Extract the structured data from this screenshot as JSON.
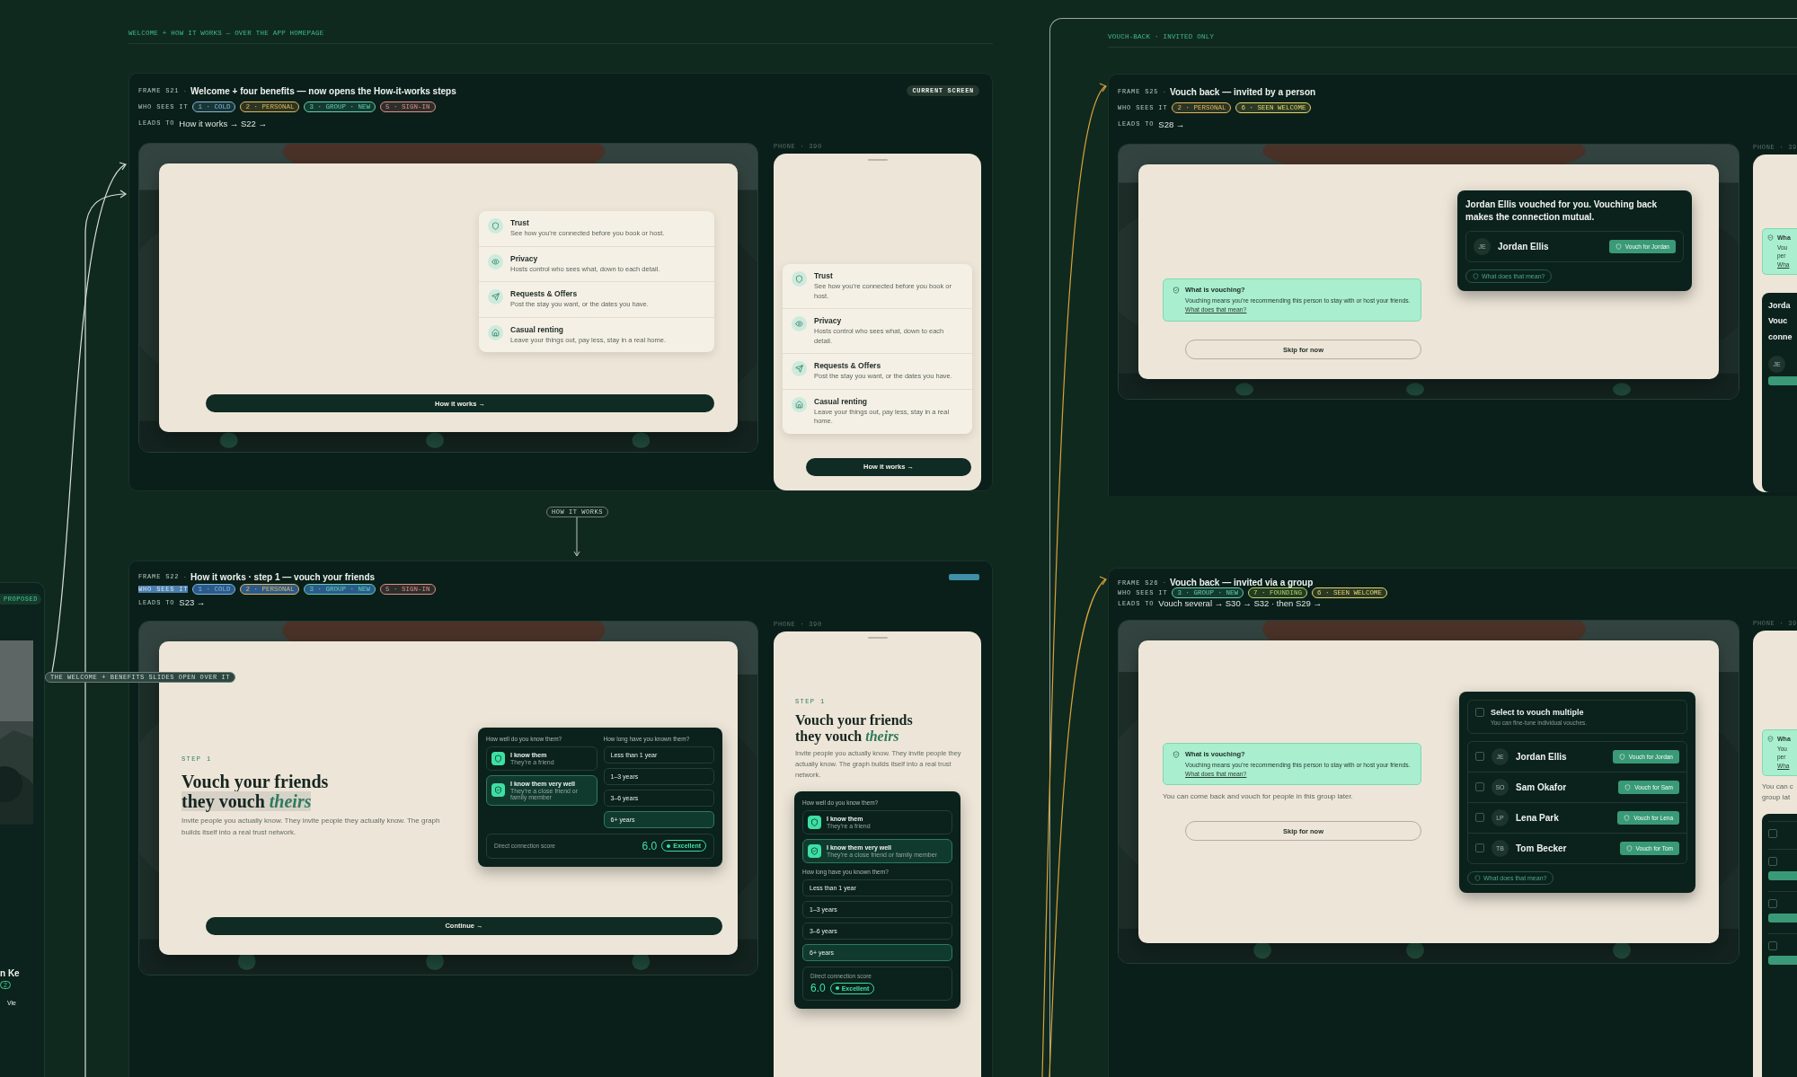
{
  "proposed_frame": {
    "tag": "PROPOSED",
    "name_fragment": "n Ke",
    "count_fragment": "2",
    "link_fragment": "Vie"
  },
  "welcome_group": {
    "label": "WELCOME + HOW IT WORKS — OVER THE APP HOMEPAGE",
    "flow_tag": "HOW IT WORKS",
    "overlay_note": "THE WELCOME + BENEFITS SLIDES OPEN OVER IT",
    "frames": [
      {
        "kind": "benefits",
        "frame_id": "FRAME S21",
        "separator": "·",
        "title": "Welcome + four benefits — now opens the How-it-works steps",
        "who_label": "WHO SEES IT",
        "who_highlighted": false,
        "audiences": [
          {
            "label": "1 · COLD",
            "color": "#7fb8d8",
            "highlighted": false
          },
          {
            "label": "2 · PERSONAL",
            "color": "#e2b45c",
            "highlighted": false
          },
          {
            "label": "3 · GROUP · NEW",
            "color": "#5fd0ae",
            "highlighted": false
          },
          {
            "label": "5 · SIGN-IN",
            "color": "#e58a8a",
            "highlighted": false
          }
        ],
        "leads_label": "LEADS TO",
        "leads_to": "How it works → S22 →",
        "badge": {
          "kind": "label",
          "text": "CURRENT SCREEN"
        },
        "phone_label": "PHONE · 390",
        "desktop": {
          "benefits": [
            {
              "title": "Trust",
              "text": "See how you’re connected before you book or host."
            },
            {
              "title": "Privacy",
              "text": "Hosts control who sees what, down to each detail."
            },
            {
              "title": "Requests & Offers",
              "text": "Post the stay you want, or the dates you have."
            },
            {
              "title": "Casual renting",
              "text": "Leave your things out, pay less, stay in a real home."
            }
          ],
          "button": "How it works →"
        },
        "phone": {
          "benefits": [
            {
              "title": "Trust",
              "text": "See how you’re connected before you book or host."
            },
            {
              "title": "Privacy",
              "text": "Hosts control who sees what, down to each detail."
            },
            {
              "title": "Requests & Offers",
              "text": "Post the stay you want, or the dates you have."
            },
            {
              "title": "Casual renting",
              "text": "Leave your things out, pay less, stay in a real home."
            }
          ],
          "button": "How it works →"
        }
      },
      {
        "kind": "step",
        "frame_id": "FRAME S22",
        "separator": "·",
        "title": "How it works · step 1 — vouch your friends",
        "who_label": "WHO SEES IT",
        "who_highlighted": true,
        "audiences": [
          {
            "label": "1 · COLD",
            "color": "#7fb8d8",
            "highlighted": true
          },
          {
            "label": "2 · PERSONAL",
            "color": "#e2b45c",
            "highlighted": true
          },
          {
            "label": "3 · GROUP · NEW",
            "color": "#5fd0ae",
            "highlighted": true
          },
          {
            "label": "5 · SIGN-IN",
            "color": "#e58a8a",
            "highlighted": false
          }
        ],
        "leads_label": "LEADS TO",
        "leads_to": "S23 →",
        "badge": {
          "kind": "blank"
        },
        "phone_label": "PHONE · 390",
        "desktop": {
          "step": "STEP 1",
          "headline": "Vouch your friends",
          "headline_2": "they vouch *theirs*",
          "headline_highlighted": true,
          "body": "Invite people you actually know. They invite people they actually know. The graph builds itself into a real trust network.",
          "picker": {
            "q_closeness": "How well do you know them?",
            "closeness": [
              {
                "title": "I know them",
                "sub": "They’re a friend",
                "selected": false
              },
              {
                "title": "I know them very well",
                "sub": "They’re a close friend or family member",
                "selected": true
              }
            ],
            "q_duration": "How long have you known them?",
            "durations": [
              {
                "label": "Less than 1 year",
                "selected": false
              },
              {
                "label": "1–3 years",
                "selected": false
              },
              {
                "label": "3–6 years",
                "selected": false
              },
              {
                "label": "6+ years",
                "selected": true
              }
            ],
            "score_label": "Direct connection score",
            "score": "6.0",
            "rating": "Excellent"
          },
          "button": "Continue →"
        },
        "phone": {
          "step": "STEP 1",
          "headline": "Vouch your friends",
          "headline_2": "they vouch *theirs*",
          "headline_highlighted": false,
          "body": "Invite people you actually know. They invite people they actually know. The graph builds itself into a real trust network.",
          "picker": {
            "q_closeness": "How well do you know them?",
            "closeness": [
              {
                "title": "I know them",
                "sub": "They’re a friend",
                "selected": false
              },
              {
                "title": "I know them very well",
                "sub": "They’re a close friend or family member",
                "selected": true
              }
            ],
            "q_duration": "How long have you known them?",
            "durations": [
              {
                "label": "Less than 1 year",
                "selected": false
              },
              {
                "label": "1–3 years",
                "selected": false
              },
              {
                "label": "3–6 years",
                "selected": false
              },
              {
                "label": "6+ years",
                "selected": true
              }
            ],
            "score_label": "Direct connection score",
            "score": "6.0",
            "rating": "Excellent"
          }
        }
      }
    ]
  },
  "vouch_back_group": {
    "label": "VOUCH-BACK · INVITED ONLY",
    "frames": [
      {
        "kind": "vouch_person",
        "frame_id": "FRAME S25",
        "separator": "·",
        "title": "Vouch back — invited by a person",
        "who_label": "WHO SEES IT",
        "who_highlighted": false,
        "audiences": [
          {
            "label": "2 · PERSONAL",
            "color": "#e2b45c",
            "highlighted": false
          },
          {
            "label": "6 · SEEN WELCOME",
            "color": "#e3d36a",
            "highlighted": false
          }
        ],
        "leads_label": "LEADS TO",
        "leads_to": "S28 →",
        "phone_label": "PHONE · 39",
        "desktop": {
          "callout": {
            "title": "What is vouching?",
            "body": "Vouching means you’re recommending this person to stay with or host your friends.",
            "link": "What does that mean?"
          },
          "skip": "Skip for now",
          "card": {
            "message": "Jordan Ellis vouched for you. Vouching back makes the connection mutual.",
            "people": [
              {
                "initials": "JE",
                "name": "Jordan Ellis",
                "action": "Vouch for Jordan"
              }
            ],
            "help": "What does that mean?"
          }
        },
        "phone": {
          "callout_title": "Wha",
          "callout_lines": [
            "Vou",
            "per",
            "Wha"
          ],
          "card_lines": [
            "Jorda",
            "Vouc",
            "conne"
          ],
          "initials": "JE"
        }
      },
      {
        "kind": "vouch_group",
        "frame_id": "FRAME S26",
        "separator": "·",
        "title": "Vouch back — invited via a group",
        "who_label": "WHO SEES IT",
        "who_highlighted": false,
        "audiences": [
          {
            "label": "3 · GROUP · NEW",
            "color": "#5fd0ae",
            "highlighted": false
          },
          {
            "label": "7 · FOUNDING",
            "color": "#b5d766",
            "highlighted": false
          },
          {
            "label": "6 · SEEN WELCOME",
            "color": "#e3d36a",
            "highlighted": false
          }
        ],
        "leads_label": "LEADS TO",
        "leads_to": "Vouch several → S30 → S32 · then S29 →",
        "phone_label": "PHONE · 39",
        "desktop": {
          "callout": {
            "title": "What is vouching?",
            "body": "Vouching means you’re recommending this person to stay with or host your friends.",
            "link": "What does that mean?"
          },
          "note": "You can come back and vouch for people in this group later.",
          "skip": "Skip for now",
          "card": {
            "select_all": {
              "title": "Select to vouch multiple",
              "sub": "You can fine-tune individual vouches.",
              "checked": false
            },
            "people": [
              {
                "initials": "JE",
                "name": "Jordan Ellis",
                "action": "Vouch for Jordan",
                "checked": false
              },
              {
                "initials": "SO",
                "name": "Sam Okafor",
                "action": "Vouch for Sam",
                "checked": false
              },
              {
                "initials": "LP",
                "name": "Lena Park",
                "action": "Vouch for Lena",
                "checked": false
              },
              {
                "initials": "TB",
                "name": "Tom Becker",
                "action": "Vouch for Tom",
                "checked": false
              }
            ],
            "help": "What does that mean?"
          }
        },
        "phone": {
          "callout_title": "Wha",
          "callout_lines": [
            "You",
            "per",
            "Wha"
          ],
          "note_lines": [
            "You can c",
            "group lat"
          ],
          "rows": [
            {
              "checked": false
            },
            {
              "checked": false
            },
            {
              "checked": false
            },
            {
              "checked": false
            }
          ]
        }
      }
    ]
  }
}
